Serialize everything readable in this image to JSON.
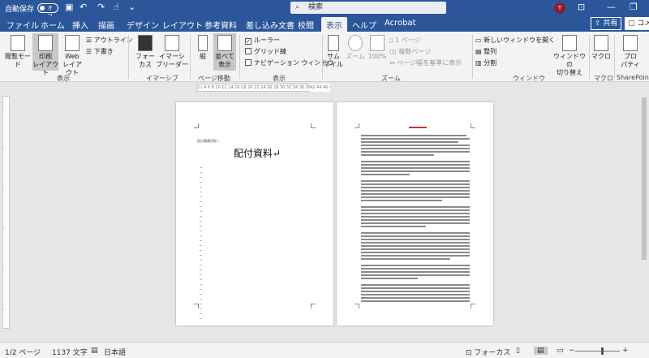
{
  "titlebar": {
    "autosave_label": "自動保存",
    "autosave_state": "オフ",
    "search_placeholder": "検索",
    "avatar_initial": "T"
  },
  "tabs": [
    "ファイル",
    "ホーム",
    "挿入",
    "描画",
    "デザイン",
    "レイアウト",
    "参考資料",
    "差し込み文書",
    "校閲",
    "表示",
    "ヘルプ",
    "Acrobat"
  ],
  "active_tab": "表示",
  "share_label": "共有",
  "comment_label": "コメント",
  "ribbon": {
    "views": {
      "read_mode": "閲覧モード",
      "print_layout_1": "印刷",
      "print_layout_2": "レイアウト",
      "web_layout_1": "Web",
      "web_layout_2": "レイアウト",
      "outline": "アウトライン",
      "draft": "下書き",
      "group": "表示"
    },
    "immersive": {
      "focus_1": "フォー",
      "focus_2": "カス",
      "reader_1": "イマーシ",
      "reader_2": "ブリーダー",
      "group": "イマーシブ"
    },
    "pagemove": {
      "vertical": "縦",
      "side_1": "並べて",
      "side_2": "表示",
      "group": "ページ移動"
    },
    "show": {
      "ruler": "ルーラー",
      "gridlines": "グリッド線",
      "navpane": "ナビゲーション ウィンドウ",
      "group": "表示"
    },
    "zoom": {
      "zoom_btn": "ズーム",
      "percent": "100%",
      "one_page": "1 ページ",
      "multi_page": "複数ページ",
      "page_width": "ページ幅を基準に表示",
      "onepage_1": "サム",
      "onepage_2": "ネイル",
      "group": "ズーム"
    },
    "window": {
      "new_window": "新しいウィンドウを開く",
      "arrange": "整列",
      "split": "分割",
      "switch_1": "ウィンドウの",
      "switch_2": "切り替え",
      "group": "ウィンドウ"
    },
    "macro": {
      "label": "マクロ",
      "group": "マクロ"
    },
    "sharepoint": {
      "label_1": "プロ",
      "label_2": "パティ",
      "group": "SharePoint"
    }
  },
  "ruler_text": "2 | 4 6 8 10 12 14 16 18 20 22 24 26 28 30 32 34 36 38 40",
  "ruler_end": "42 44 46 48",
  "document": {
    "header_small": "提出書類用紙一",
    "title": "配付資料↵"
  },
  "status": {
    "page": "1/2 ページ",
    "words": "1137 文字",
    "language": "日本語",
    "focus": "フォーカス",
    "zoom_minus": "−",
    "zoom_plus": "+"
  }
}
